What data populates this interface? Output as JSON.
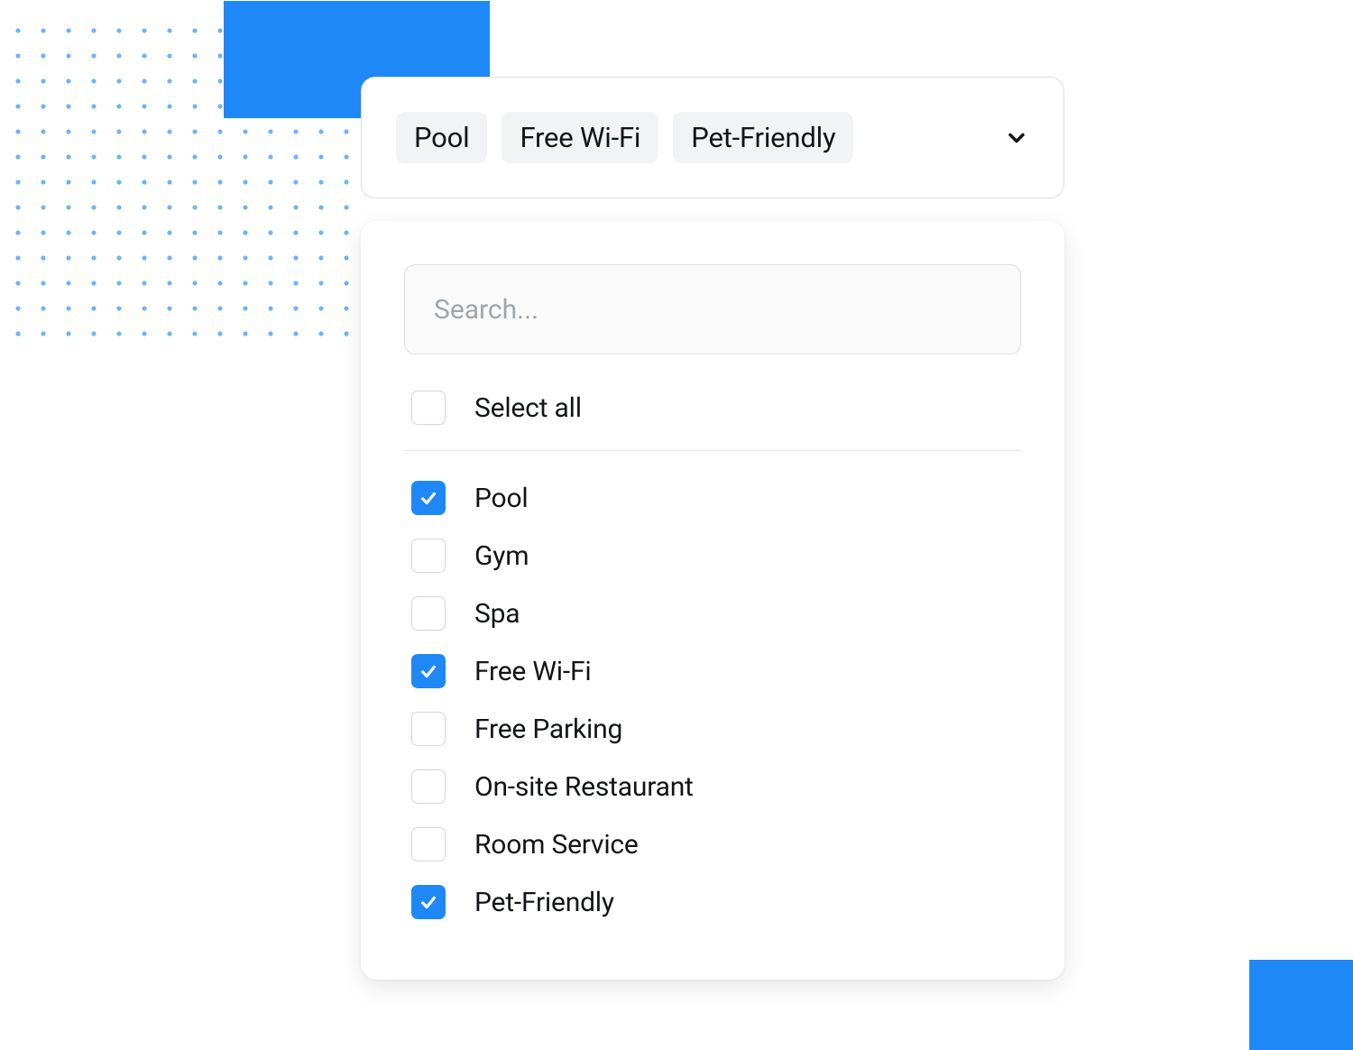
{
  "colors": {
    "accent": "#1e88f7",
    "chip_bg": "#f2f3f5",
    "border": "#dcdfe4"
  },
  "select": {
    "chips": [
      "Pool",
      "Free Wi-Fi",
      "Pet-Friendly"
    ],
    "chevron_icon": "chevron-down-icon"
  },
  "dropdown": {
    "search": {
      "placeholder": "Search...",
      "value": ""
    },
    "select_all": {
      "label": "Select all",
      "checked": false
    },
    "options": [
      {
        "label": "Pool",
        "checked": true
      },
      {
        "label": "Gym",
        "checked": false
      },
      {
        "label": "Spa",
        "checked": false
      },
      {
        "label": "Free Wi-Fi",
        "checked": true
      },
      {
        "label": "Free Parking",
        "checked": false
      },
      {
        "label": "On-site Restaurant",
        "checked": false
      },
      {
        "label": "Room Service",
        "checked": false
      },
      {
        "label": "Pet-Friendly",
        "checked": true
      }
    ]
  }
}
